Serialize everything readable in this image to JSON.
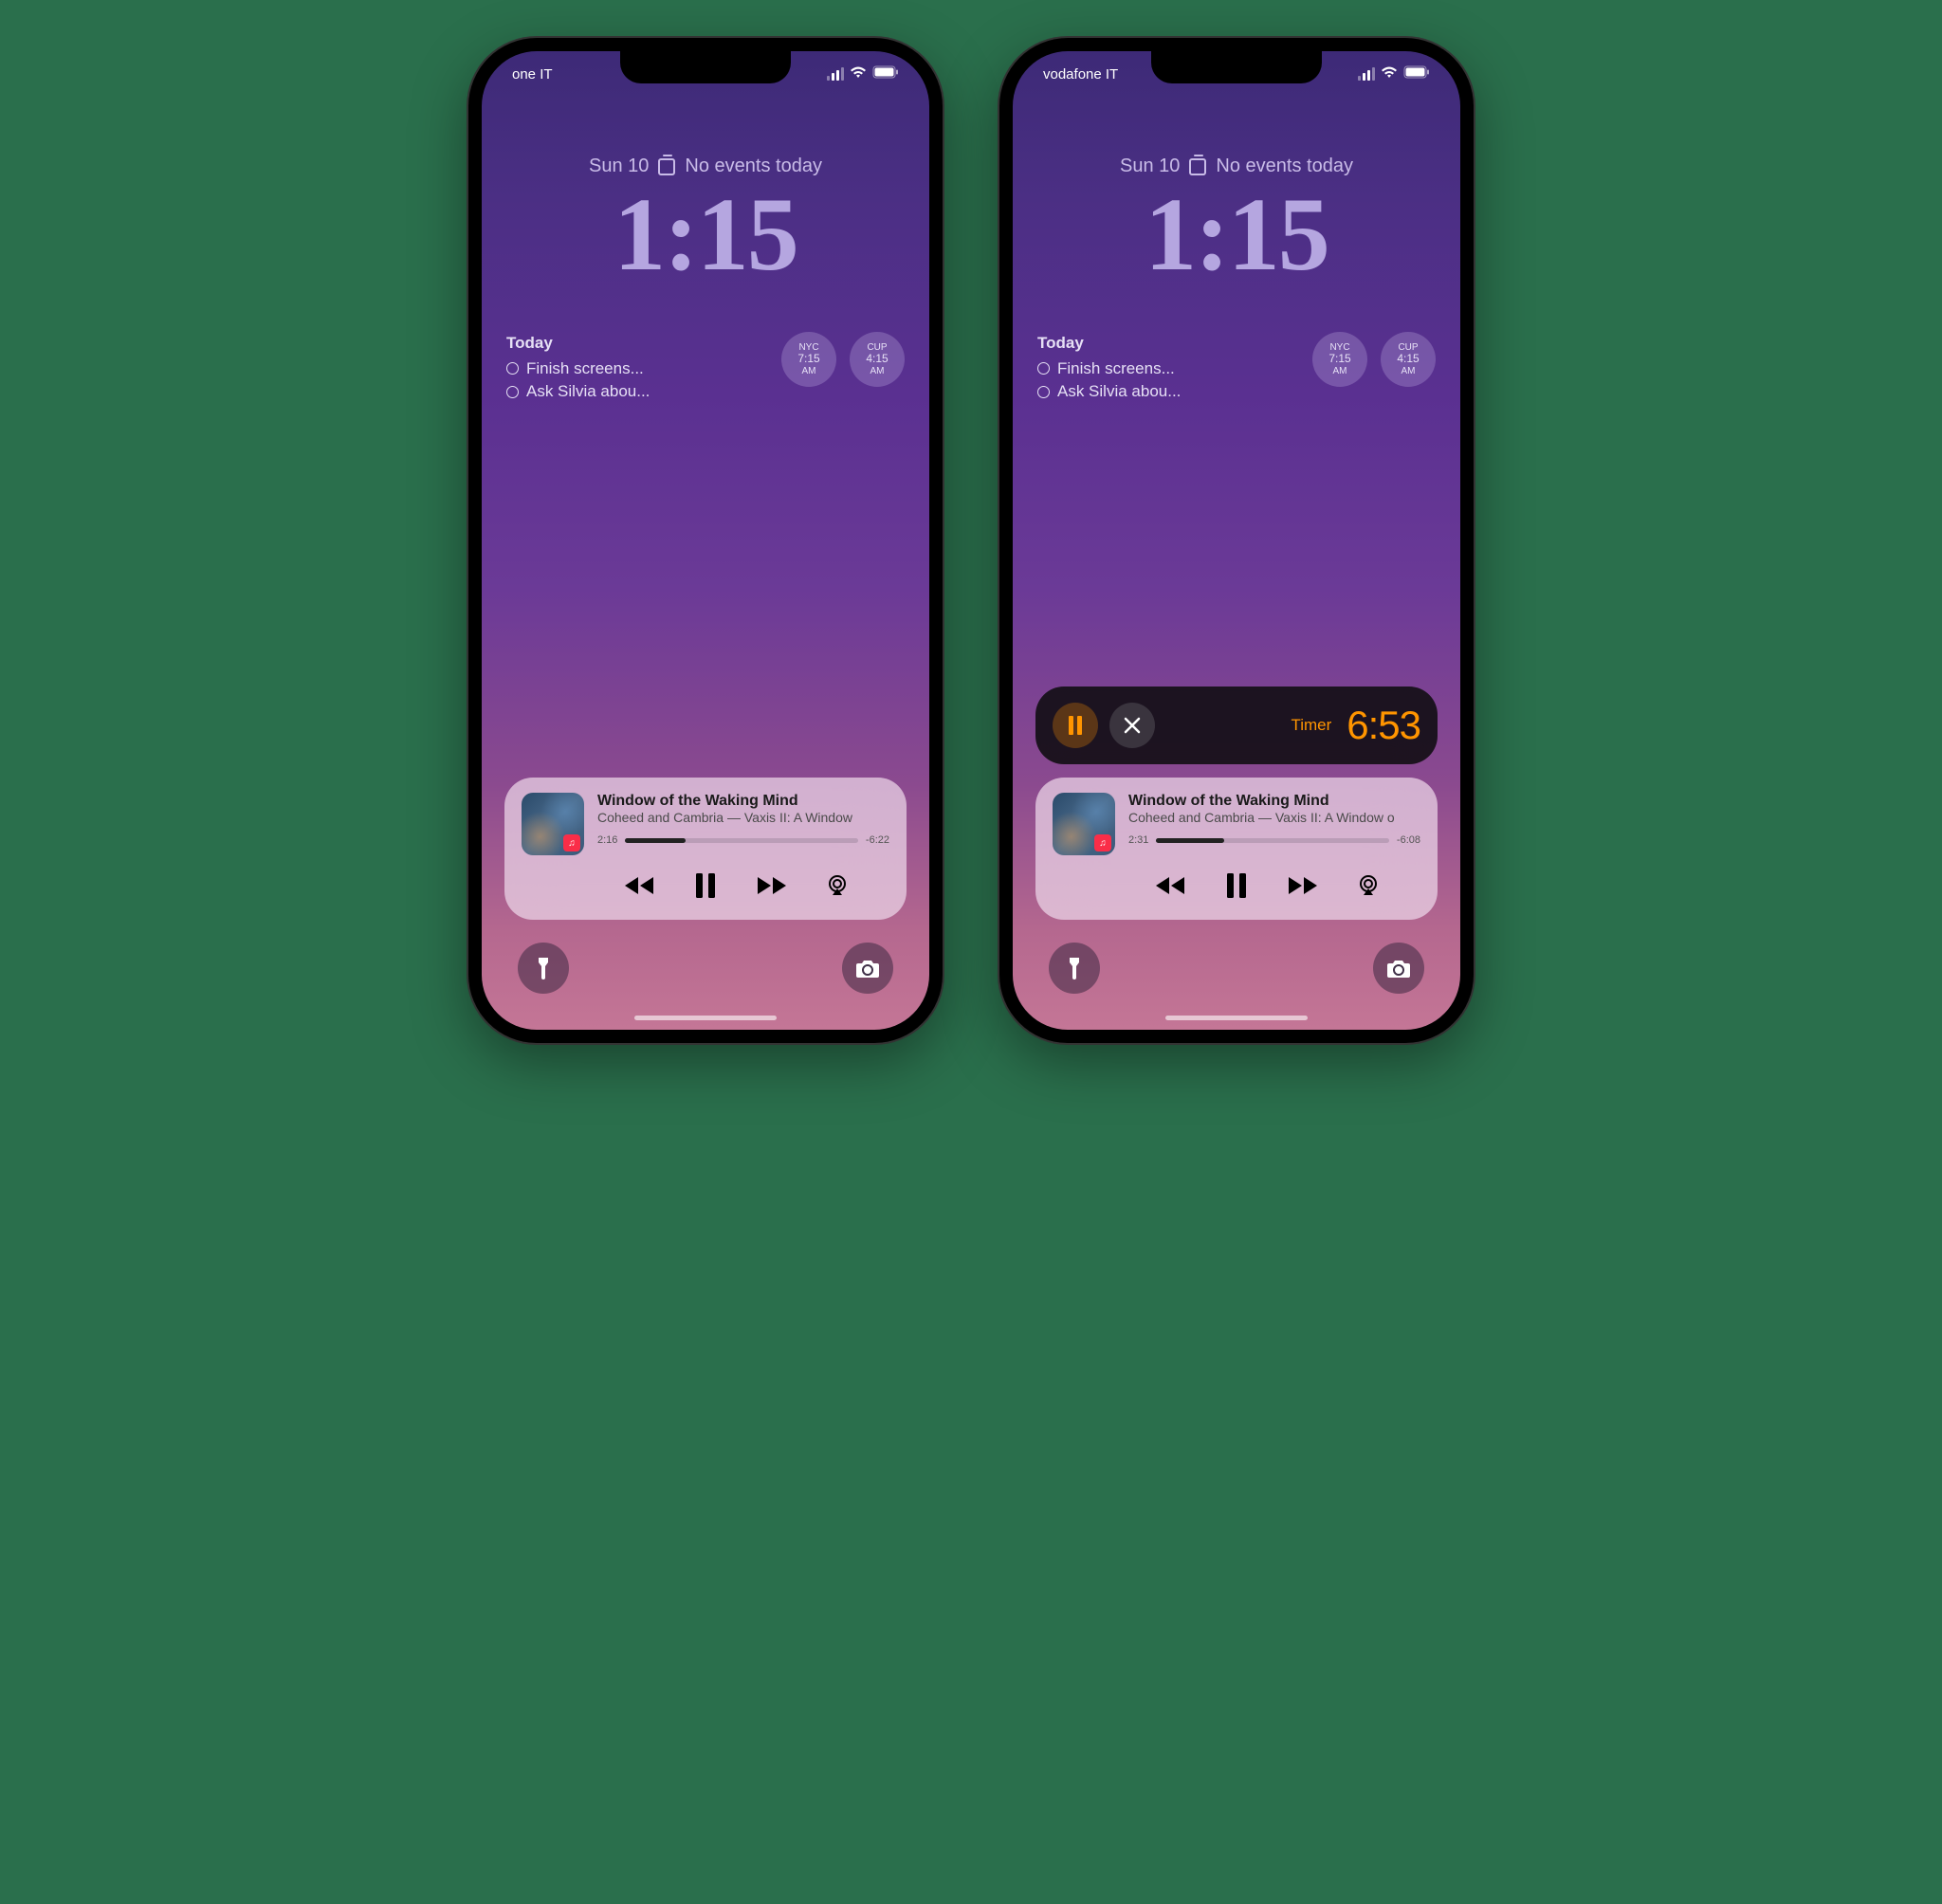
{
  "phones": [
    {
      "status": {
        "carrier": "one IT"
      },
      "date": "Sun 10",
      "calendar_summary": "No events today",
      "clock": "1:15",
      "todo": {
        "title": "Today",
        "items": [
          "Finish screens...",
          "Ask Silvia abou..."
        ]
      },
      "world_clocks": [
        {
          "city": "NYC",
          "time": "7:15",
          "ampm": "AM"
        },
        {
          "city": "CUP",
          "time": "4:15",
          "ampm": "AM"
        }
      ],
      "timer": null,
      "music": {
        "title": "Window of the Waking Mind",
        "artist": "Coheed and Cambria — Vaxis II: A Window",
        "elapsed": "2:16",
        "remaining": "-6:22",
        "progress_pct": 26
      }
    },
    {
      "status": {
        "carrier": "vodafone IT"
      },
      "date": "Sun 10",
      "calendar_summary": "No events today",
      "clock": "1:15",
      "todo": {
        "title": "Today",
        "items": [
          "Finish screens...",
          "Ask Silvia abou..."
        ]
      },
      "world_clocks": [
        {
          "city": "NYC",
          "time": "7:15",
          "ampm": "AM"
        },
        {
          "city": "CUP",
          "time": "4:15",
          "ampm": "AM"
        }
      ],
      "timer": {
        "label": "Timer",
        "value": "6:53"
      },
      "music": {
        "title": "Window of the Waking Mind",
        "artist": "Coheed and Cambria — Vaxis II: A Window o",
        "elapsed": "2:31",
        "remaining": "-6:08",
        "progress_pct": 29
      }
    }
  ],
  "icons": {
    "apple_music_badge": "♫"
  }
}
